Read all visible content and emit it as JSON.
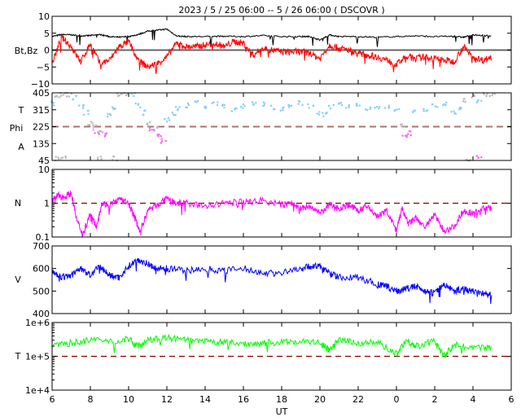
{
  "title": "2023 /  5 / 25   06:00 --  5 / 26   06:00 ( DSCOVR )",
  "chart_data": [
    {
      "type": "line",
      "panel_label": "Bt,Bz",
      "ylim": [
        -10,
        10
      ],
      "yticks": [
        "10",
        "5",
        "0",
        "−5",
        "−10"
      ],
      "ytick_values": [
        10,
        5,
        0,
        -5,
        -10
      ],
      "reference_line": 0,
      "series": [
        {
          "name": "Bt",
          "color": "#000000",
          "x": [
            6,
            6.5,
            7,
            7.5,
            8,
            8.5,
            9,
            9.5,
            10,
            10.5,
            11,
            11.5,
            12,
            12.5,
            13,
            14,
            15,
            16,
            17,
            18,
            19,
            19.5,
            20,
            20.5,
            21,
            22,
            23,
            24,
            25,
            26,
            27,
            27.5,
            28,
            29
          ],
          "values": [
            4,
            4.6,
            4.5,
            4.2,
            4.3,
            4.6,
            4,
            3.8,
            4,
            4.6,
            5.6,
            5.9,
            6.2,
            4.2,
            4,
            4,
            4.1,
            4,
            4.3,
            4,
            4,
            4,
            3,
            4.5,
            4,
            4,
            3.8,
            4,
            4.2,
            4,
            4.1,
            3.8,
            4.5,
            4.2
          ]
        },
        {
          "name": "Bz",
          "color": "#ff0000",
          "x": [
            6,
            6.5,
            7,
            7.5,
            8,
            8.5,
            9,
            9.5,
            10,
            10.5,
            11,
            11.5,
            12,
            12.5,
            13,
            13.5,
            14,
            14.5,
            15,
            15.5,
            16,
            16.5,
            17,
            17.5,
            18,
            18.5,
            19,
            19.5,
            20,
            20.5,
            21,
            21.5,
            22,
            22.5,
            23,
            23.5,
            24,
            24.5,
            25,
            25.5,
            26,
            26.5,
            27,
            27.5,
            28,
            28.5,
            29
          ],
          "values": [
            -4,
            3.8,
            1,
            -3.5,
            2,
            -4,
            -3,
            1,
            2.5,
            -3,
            -5,
            -4,
            -2,
            2,
            1,
            1,
            1.5,
            2,
            1,
            2.5,
            2,
            -1.5,
            0.5,
            0,
            -0.5,
            -0.5,
            -0.5,
            -1,
            -2.5,
            1.5,
            0.5,
            0,
            -1,
            -1.5,
            -2,
            -3,
            -4.2,
            -2,
            -2.5,
            -2,
            -2.5,
            -3,
            -3.5,
            1,
            -2,
            -3,
            -2
          ]
        }
      ]
    },
    {
      "type": "scatter",
      "panel_label": [
        "T",
        "Phi",
        "A"
      ],
      "ylim": [
        45,
        405
      ],
      "yticks": [
        "405",
        "315",
        "225",
        "135",
        "45"
      ],
      "ytick_values": [
        405,
        315,
        225,
        135,
        45
      ],
      "reference_line": 225,
      "colors": {
        "T": "#87cefa",
        "A": "#ff66ff",
        "other": "#bbbbbb"
      },
      "points": [
        [
          6.1,
          350,
          "T"
        ],
        [
          6.3,
          390,
          "other"
        ],
        [
          6.6,
          400,
          "other"
        ],
        [
          6.9,
          395,
          "other"
        ],
        [
          7.2,
          380,
          "T"
        ],
        [
          7.5,
          330,
          "T"
        ],
        [
          7.8,
          300,
          "T"
        ],
        [
          8.0,
          240,
          "other"
        ],
        [
          8.2,
          220,
          "other"
        ],
        [
          8.3,
          185,
          "A"
        ],
        [
          8.5,
          205,
          "other"
        ],
        [
          8.8,
          185,
          "A"
        ],
        [
          9.0,
          290,
          "T"
        ],
        [
          9.3,
          320,
          "T"
        ],
        [
          9.5,
          390,
          "other"
        ],
        [
          9.8,
          400,
          "other"
        ],
        [
          10.2,
          395,
          "T"
        ],
        [
          10.5,
          340,
          "T"
        ],
        [
          10.8,
          300,
          "T"
        ],
        [
          11.0,
          240,
          "other"
        ],
        [
          11.2,
          205,
          "A"
        ],
        [
          11.4,
          215,
          "other"
        ],
        [
          11.6,
          180,
          "A"
        ],
        [
          11.8,
          150,
          "A"
        ],
        [
          12.0,
          260,
          "T"
        ],
        [
          12.3,
          290,
          "T"
        ],
        [
          12.6,
          320,
          "T"
        ],
        [
          13.0,
          340,
          "T"
        ],
        [
          13.5,
          355,
          "T"
        ],
        [
          14.0,
          330,
          "T"
        ],
        [
          14.5,
          345,
          "T"
        ],
        [
          15.0,
          330,
          "T"
        ],
        [
          15.5,
          320,
          "T"
        ],
        [
          16.0,
          335,
          "T"
        ],
        [
          16.5,
          350,
          "T"
        ],
        [
          17.0,
          345,
          "T"
        ],
        [
          17.5,
          325,
          "T"
        ],
        [
          18.0,
          320,
          "T"
        ],
        [
          18.5,
          340,
          "T"
        ],
        [
          19.0,
          350,
          "T"
        ],
        [
          19.5,
          335,
          "T"
        ],
        [
          20.0,
          300,
          "T"
        ],
        [
          20.3,
          290,
          "T"
        ],
        [
          20.6,
          330,
          "T"
        ],
        [
          21.0,
          345,
          "T"
        ],
        [
          21.5,
          330,
          "T"
        ],
        [
          22.0,
          340,
          "T"
        ],
        [
          22.5,
          320,
          "T"
        ],
        [
          23.0,
          330,
          "T"
        ],
        [
          23.5,
          335,
          "T"
        ],
        [
          24.0,
          320,
          "T"
        ],
        [
          24.3,
          230,
          "other"
        ],
        [
          24.4,
          170,
          "A"
        ],
        [
          24.6,
          190,
          "A"
        ],
        [
          25.0,
          300,
          "T"
        ],
        [
          25.5,
          320,
          "T"
        ],
        [
          26.0,
          340,
          "T"
        ],
        [
          26.5,
          350,
          "T"
        ],
        [
          27.0,
          300,
          "T"
        ],
        [
          27.3,
          320,
          "T"
        ],
        [
          27.6,
          370,
          "other"
        ],
        [
          28.0,
          390,
          "other"
        ],
        [
          28.3,
          360,
          "T"
        ],
        [
          28.6,
          400,
          "other"
        ],
        [
          29.0,
          395,
          "other"
        ],
        [
          6.3,
          55,
          "other"
        ],
        [
          6.6,
          55,
          "other"
        ],
        [
          8.5,
          55,
          "other"
        ],
        [
          9.3,
          55,
          "other"
        ],
        [
          28.3,
          60,
          "A"
        ],
        [
          27.8,
          50,
          "other"
        ]
      ]
    },
    {
      "type": "line",
      "panel_label": "N",
      "scale": "log",
      "ylim": [
        0.1,
        10
      ],
      "yticks": [
        "10",
        "1",
        "0.1"
      ],
      "ytick_values": [
        10,
        1,
        0.1
      ],
      "reference_line": 1,
      "series": [
        {
          "name": "N",
          "color": "#ff00ff",
          "x": [
            6,
            6.3,
            6.6,
            7,
            7.3,
            7.6,
            8,
            8.3,
            8.6,
            9,
            9.5,
            10,
            10.3,
            10.6,
            11,
            11.5,
            12,
            12.5,
            13,
            14,
            15,
            16,
            17,
            18,
            18.5,
            19,
            19.5,
            20,
            20.5,
            21,
            21.5,
            22,
            22.5,
            23,
            23.5,
            24,
            24.3,
            24.6,
            25,
            25.5,
            26,
            26.5,
            27,
            27.5,
            28,
            28.5,
            29
          ],
          "values": [
            1.2,
            1.7,
            1.5,
            2,
            0.3,
            0.12,
            0.5,
            0.2,
            1,
            0.9,
            1.3,
            1,
            0.4,
            0.15,
            0.6,
            0.9,
            1.3,
            1,
            1,
            0.8,
            1,
            1.1,
            1.2,
            0.9,
            1,
            0.7,
            0.8,
            0.5,
            0.9,
            0.7,
            0.9,
            0.6,
            0.8,
            0.4,
            0.6,
            0.15,
            0.7,
            0.25,
            0.35,
            0.2,
            0.45,
            0.15,
            0.2,
            0.6,
            0.5,
            0.7,
            0.7
          ]
        }
      ]
    },
    {
      "type": "line",
      "panel_label": "V",
      "ylim": [
        400,
        700
      ],
      "yticks": [
        "700",
        "600",
        "500",
        "400"
      ],
      "ytick_values": [
        700,
        600,
        500,
        400
      ],
      "series": [
        {
          "name": "V",
          "color": "#0000ff",
          "x": [
            6,
            6.5,
            7,
            7.5,
            8,
            8.5,
            9,
            9.5,
            10,
            10.5,
            11,
            11.5,
            12,
            13,
            14,
            15,
            16,
            17,
            18,
            19,
            19.5,
            20,
            20.5,
            21,
            22,
            23,
            23.5,
            24,
            24.5,
            25,
            25.5,
            26,
            26.5,
            27,
            27.5,
            28,
            28.5,
            29
          ],
          "values": [
            590,
            560,
            570,
            600,
            570,
            610,
            570,
            560,
            610,
            640,
            620,
            600,
            600,
            590,
            600,
            590,
            600,
            580,
            580,
            600,
            610,
            610,
            580,
            560,
            560,
            530,
            520,
            500,
            510,
            520,
            500,
            490,
            530,
            500,
            510,
            500,
            490,
            480
          ]
        }
      ]
    },
    {
      "type": "line",
      "panel_label": "T",
      "scale": "log",
      "ylim": [
        10000,
        1000000
      ],
      "yticks": [
        "1e+6",
        "1e+5",
        "1e+4"
      ],
      "ytick_values": [
        1000000,
        100000,
        10000
      ],
      "reference_line": 100000,
      "series": [
        {
          "name": "T",
          "color": "#00ff00",
          "x": [
            6,
            7,
            8,
            9,
            10,
            10.5,
            11,
            12,
            13,
            14,
            15,
            16,
            17,
            18,
            19,
            20,
            20.5,
            21,
            22,
            23,
            24,
            24.5,
            25,
            26,
            26.5,
            27,
            28,
            29
          ],
          "values": [
            200000,
            250000,
            300000,
            280000,
            320000,
            200000,
            300000,
            350000,
            300000,
            270000,
            260000,
            230000,
            250000,
            260000,
            280000,
            250000,
            150000,
            300000,
            250000,
            260000,
            120000,
            300000,
            200000,
            280000,
            100000,
            220000,
            180000,
            180000
          ]
        }
      ]
    }
  ],
  "xaxis": {
    "label": "UT",
    "xlim": [
      6,
      30
    ],
    "tick_values": [
      6,
      8,
      10,
      12,
      14,
      16,
      18,
      20,
      22,
      24,
      26,
      28,
      30
    ],
    "tick_labels": [
      "6",
      "8",
      "10",
      "12",
      "14",
      "16",
      "18",
      "20",
      "22",
      "0",
      "2",
      "4",
      "6"
    ]
  }
}
